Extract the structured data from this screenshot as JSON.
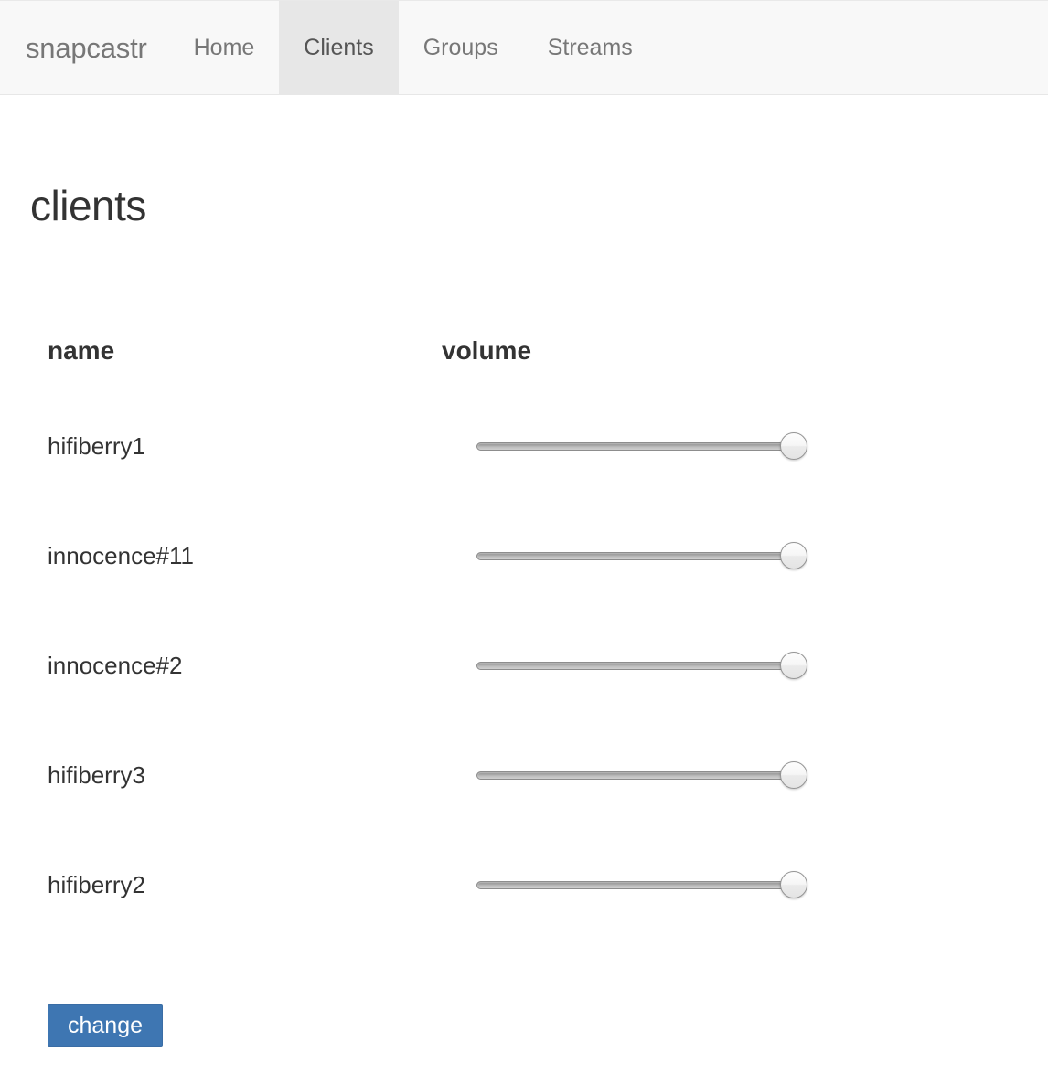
{
  "navbar": {
    "brand": "snapcastr",
    "links": [
      {
        "label": "Home",
        "active": false
      },
      {
        "label": "Clients",
        "active": true
      },
      {
        "label": "Groups",
        "active": false
      },
      {
        "label": "Streams",
        "active": false
      }
    ],
    "background_color": "#f8f8f8",
    "active_background_color": "#e7e7e7",
    "link_color": "#777777",
    "active_link_color": "#555555"
  },
  "page": {
    "title": "clients"
  },
  "table": {
    "headers": {
      "name": "name",
      "volume": "volume"
    },
    "rows": [
      {
        "name": "hifiberry1",
        "volume": 100
      },
      {
        "name": "innocence#11",
        "volume": 100
      },
      {
        "name": "innocence#2",
        "volume": 100
      },
      {
        "name": "hifiberry3",
        "volume": 100
      },
      {
        "name": "hifiberry2",
        "volume": 100
      }
    ]
  },
  "actions": {
    "change_label": "change",
    "change_color": "#3e76b2"
  }
}
